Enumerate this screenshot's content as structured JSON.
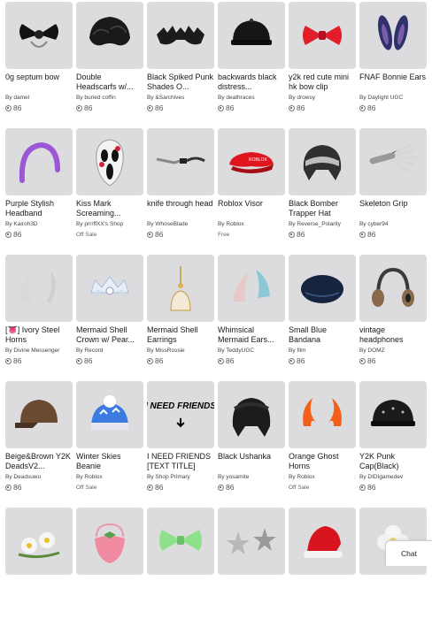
{
  "items": [
    {
      "name": "0g septum bow",
      "creator": "damel",
      "price": "86",
      "icon": "septum-bow-icon"
    },
    {
      "name": "Double Headscarfs w/...",
      "creator": "buried coffin",
      "price": "86",
      "icon": "black-hair-icon"
    },
    {
      "name": "Black Spiked Punk Shades O...",
      "creator": "&Sarchives",
      "price": "86",
      "icon": "spiked-shades-icon"
    },
    {
      "name": "backwards black distress...",
      "creator": "deathraces",
      "price": "86",
      "icon": "black-cap-icon"
    },
    {
      "name": "y2k red cute mini hk bow clip",
      "creator": "drowsy",
      "price": "86",
      "icon": "red-bow-icon"
    },
    {
      "name": "FNAF Bonnie Ears",
      "creator": "Daylight UGC",
      "price": "86",
      "icon": "bonnie-ears-icon"
    },
    {
      "name": "Purple Stylish Headband",
      "creator": "Kairoh3D",
      "price": "86",
      "icon": "purple-headband-icon"
    },
    {
      "name": "Kiss Mark Screaming...",
      "creator": "prrrffXX's Shop",
      "price": "Off Sale",
      "icon": "scream-mask-icon"
    },
    {
      "name": "knife through head",
      "creator": "WhoseBlade",
      "price": "86",
      "icon": "knife-icon"
    },
    {
      "name": "Roblox Visor",
      "creator": "Roblox",
      "price": "Free",
      "icon": "red-visor-icon"
    },
    {
      "name": "Black Bomber Trapper Hat",
      "creator": "Reverse_Polarity",
      "price": "86",
      "icon": "trapper-hat-icon"
    },
    {
      "name": "Skeleton Grip",
      "creator": "cyber94",
      "price": "86",
      "icon": "skeleton-hand-icon"
    },
    {
      "name": "[👅] Ivory Steel Horns",
      "creator": "Divine Messenger",
      "price": "86",
      "icon": "ivory-horns-icon"
    },
    {
      "name": "Mermaid Shell Crown w/ Pear...",
      "creator": "Record",
      "price": "86",
      "icon": "shell-crown-icon"
    },
    {
      "name": "Mermaid Shell Earrings",
      "creator": "MissRossie",
      "price": "86",
      "icon": "shell-earrings-icon"
    },
    {
      "name": "Whimsical Mermaid Ears...",
      "creator": "TeddyUGC",
      "price": "86",
      "icon": "mermaid-ears-icon"
    },
    {
      "name": "Small Blue Bandana",
      "creator": "film",
      "price": "86",
      "icon": "blue-bandana-icon"
    },
    {
      "name": "vintage headphones",
      "creator": "DOMZ",
      "price": "86",
      "icon": "headphones-icon"
    },
    {
      "name": "Beige&Brown Y2K DeadsV2...",
      "creator": "Deadsuwu",
      "price": "86",
      "icon": "brown-cap-icon"
    },
    {
      "name": "Winter Skies Beanie",
      "creator": "Roblox",
      "price": "Off Sale",
      "icon": "beanie-icon"
    },
    {
      "name": "I NEED FRIENDS [TEXT TITLE]",
      "creator": "Shop Primary",
      "price": "86",
      "icon": "text-title-icon",
      "thumb_text": "I NEED FRIENDS"
    },
    {
      "name": "Black Ushanka",
      "creator": "yosamite",
      "price": "86",
      "icon": "ushanka-icon"
    },
    {
      "name": "Orange Ghost Horns",
      "creator": "Roblox",
      "price": "Off Sale",
      "icon": "orange-horns-icon"
    },
    {
      "name": "Y2K Punk Cap(Black)",
      "creator": "DIDIgamedev",
      "price": "86",
      "icon": "punk-cap-icon"
    },
    {
      "name": "",
      "creator": "",
      "price": "",
      "icon": "daisy-crown-icon"
    },
    {
      "name": "",
      "creator": "",
      "price": "",
      "icon": "strawberry-bag-icon"
    },
    {
      "name": "",
      "creator": "",
      "price": "",
      "icon": "green-bow-icon"
    },
    {
      "name": "",
      "creator": "",
      "price": "",
      "icon": "silver-stars-icon"
    },
    {
      "name": "",
      "creator": "",
      "price": "",
      "icon": "santa-hat-icon"
    },
    {
      "name": "",
      "creator": "",
      "price": "",
      "icon": "white-flower-icon"
    }
  ],
  "by_prefix": "By",
  "chat_label": "Chat"
}
